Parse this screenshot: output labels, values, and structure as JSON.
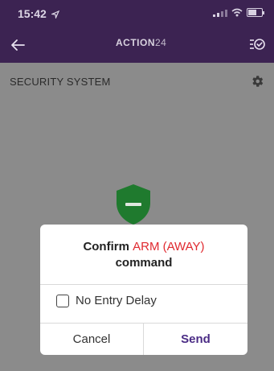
{
  "status_bar": {
    "time": "15:42"
  },
  "nav": {
    "logo_text": "ACTION",
    "logo_number": "24"
  },
  "page": {
    "section_title": "SECURITY SYSTEM"
  },
  "dialog": {
    "message_prefix": "Confirm ",
    "message_highlight": "ARM (AWAY)",
    "message_suffix": "command",
    "checkbox_label": "No Entry Delay",
    "checkbox_checked": false,
    "cancel_label": "Cancel",
    "send_label": "Send"
  },
  "colors": {
    "header_bg": "#3c2352",
    "highlight_red": "#e0292f",
    "send_purple": "#4b2c85",
    "shield_green": "#1f7a2e"
  },
  "icons": [
    "location-arrow-icon",
    "signal-icon",
    "wifi-icon",
    "battery-icon",
    "back-arrow-icon",
    "checklist-icon",
    "gear-icon",
    "shield-icon"
  ]
}
